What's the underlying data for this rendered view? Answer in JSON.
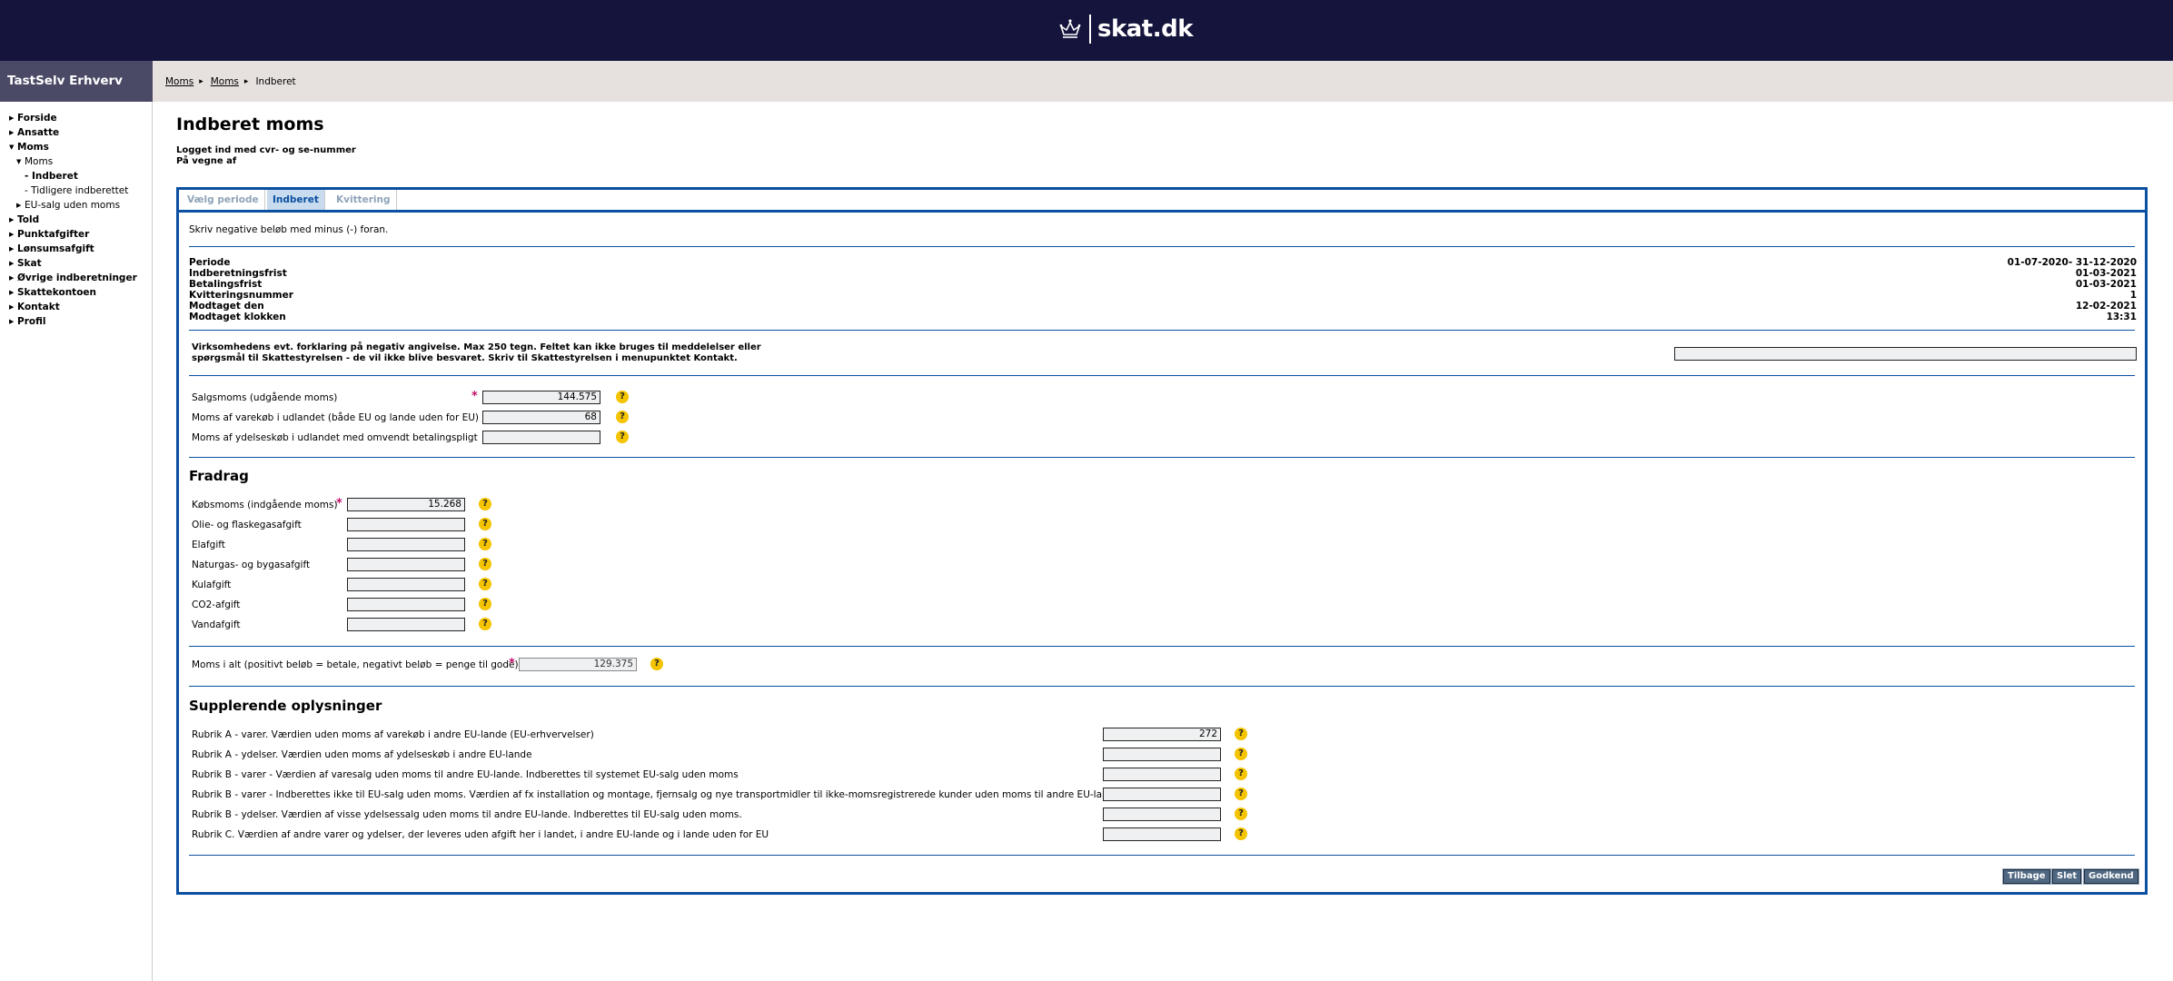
{
  "header": {
    "brand": "skat.dk",
    "brand_icon": "crown-icon",
    "colors": {
      "topbar": "#14143c",
      "accent": "#0a4fa0",
      "help": "#f5c400",
      "required": "#c0106a"
    }
  },
  "sidebar": {
    "title": "TastSelv Erhverv",
    "items": [
      {
        "label": "Forside",
        "level": 0,
        "expanded": false,
        "bold": true
      },
      {
        "label": "Ansatte",
        "level": 0,
        "expanded": false,
        "bold": true
      },
      {
        "label": "Moms",
        "level": 0,
        "expanded": true,
        "bold": true
      },
      {
        "label": "Moms",
        "level": 1,
        "expanded": true,
        "bold": false
      },
      {
        "label": "Indberet",
        "level": 2,
        "bold": true
      },
      {
        "label": "Tidligere indberettet",
        "level": 2,
        "bold": false
      },
      {
        "label": "EU-salg uden moms",
        "level": 1,
        "expanded": false,
        "bold": false
      },
      {
        "label": "Told",
        "level": 0,
        "bold": true
      },
      {
        "label": "Punktafgifter",
        "level": 0,
        "bold": true
      },
      {
        "label": "Lønsumsafgift",
        "level": 0,
        "bold": true
      },
      {
        "label": "Skat",
        "level": 0,
        "bold": true
      },
      {
        "label": "Øvrige indberetninger",
        "level": 0,
        "bold": true
      },
      {
        "label": "Skattekontoen",
        "level": 0,
        "bold": true
      },
      {
        "label": "Kontakt",
        "level": 0,
        "bold": true
      },
      {
        "label": "Profil",
        "level": 0,
        "bold": true
      }
    ]
  },
  "breadcrumb": [
    "Moms",
    "Moms",
    "Indberet"
  ],
  "page": {
    "title": "Indberet moms",
    "login_line": "Logget ind med cvr- og se-nummer",
    "behalf_line": "På vegne af"
  },
  "tabs": [
    "Vælg periode",
    "Indberet",
    "Kvittering"
  ],
  "active_tab": "Indberet",
  "hint": "Skriv negative beløb med minus (-) foran.",
  "info": [
    {
      "label": "Periode",
      "value": "01-07-2020- 31-12-2020"
    },
    {
      "label": "Indberetningsfrist",
      "value": "01-03-2021"
    },
    {
      "label": "Betalingsfrist",
      "value": "01-03-2021"
    },
    {
      "label": "Kvitteringsnummer",
      "value": "1"
    },
    {
      "label": "Modtaget den",
      "value": "12-02-2021"
    },
    {
      "label": "Modtaget klokken",
      "value": "13:31"
    }
  ],
  "explanation": {
    "line1": "Virksomhedens evt. forklaring på negativ angivelse. Max 250 tegn. Feltet kan ikke bruges til meddelelser eller",
    "line2": "spørgsmål til Skattestyrelsen - de vil ikke blive besvaret. Skriv til Skattestyrelsen i menupunktet Kontakt.",
    "value": ""
  },
  "sales": [
    {
      "label": "Salgsmoms (udgående moms)",
      "value": "144.575",
      "required": true
    },
    {
      "label": "Moms af varekøb i udlandet (både EU og lande uden for EU)",
      "value": "68",
      "required": false
    },
    {
      "label": "Moms af ydelseskøb i udlandet med omvendt betalingspligt",
      "value": "",
      "required": false
    }
  ],
  "fradrag": {
    "title": "Fradrag",
    "rows": [
      {
        "label": "Købsmoms (indgående moms)",
        "value": "15.268",
        "required": true
      },
      {
        "label": "Olie- og flaskegasafgift",
        "value": ""
      },
      {
        "label": "Elafgift",
        "value": ""
      },
      {
        "label": "Naturgas- og bygasafgift",
        "value": ""
      },
      {
        "label": "Kulafgift",
        "value": ""
      },
      {
        "label": "CO2-afgift",
        "value": ""
      },
      {
        "label": "Vandafgift",
        "value": ""
      }
    ]
  },
  "total": {
    "label": "Moms i alt (positivt beløb = betale, negativt beløb = penge til gode)",
    "value": "129.375"
  },
  "supplerende": {
    "title": "Supplerende oplysninger",
    "rows": [
      {
        "label": "Rubrik A - varer. Værdien uden moms af varekøb i andre EU-lande (EU-erhvervelser)",
        "value": "272"
      },
      {
        "label": "Rubrik A - ydelser. Værdien uden moms af ydelseskøb i andre EU-lande",
        "value": ""
      },
      {
        "label": "Rubrik B - varer - Værdien af varesalg uden moms til andre EU-lande. Indberettes til systemet EU-salg uden moms",
        "value": ""
      },
      {
        "label": "Rubrik B - varer - Indberettes ikke til EU-salg uden moms. Værdien af fx installation og montage, fjernsalg og nye transportmidler til ikke-momsregistrerede kunder uden moms til andre EU-lande",
        "value": ""
      },
      {
        "label": "Rubrik B - ydelser. Værdien af visse ydelsessalg uden moms til andre EU-lande. Indberettes til EU-salg uden moms.",
        "value": ""
      },
      {
        "label": "Rubrik C. Værdien af andre varer og ydelser, der leveres uden afgift her i landet, i andre EU-lande og i lande uden for EU",
        "value": ""
      }
    ]
  },
  "buttons": {
    "back": "Tilbage",
    "delete": "Slet",
    "approve": "Godkend"
  },
  "help_glyph": "?",
  "required_glyph": "*"
}
